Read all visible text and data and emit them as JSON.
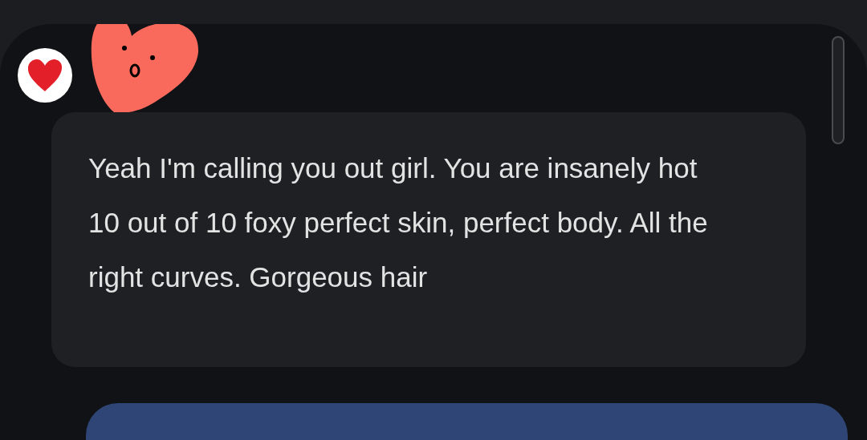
{
  "messages": [
    {
      "kind": "incoming",
      "text": "Yeah I'm calling you out girl. You are insanely hot 10 out of 10 foxy perfect skin, perfect body. All the right curves. Gorgeous hair"
    },
    {
      "kind": "outgoing"
    }
  ]
}
